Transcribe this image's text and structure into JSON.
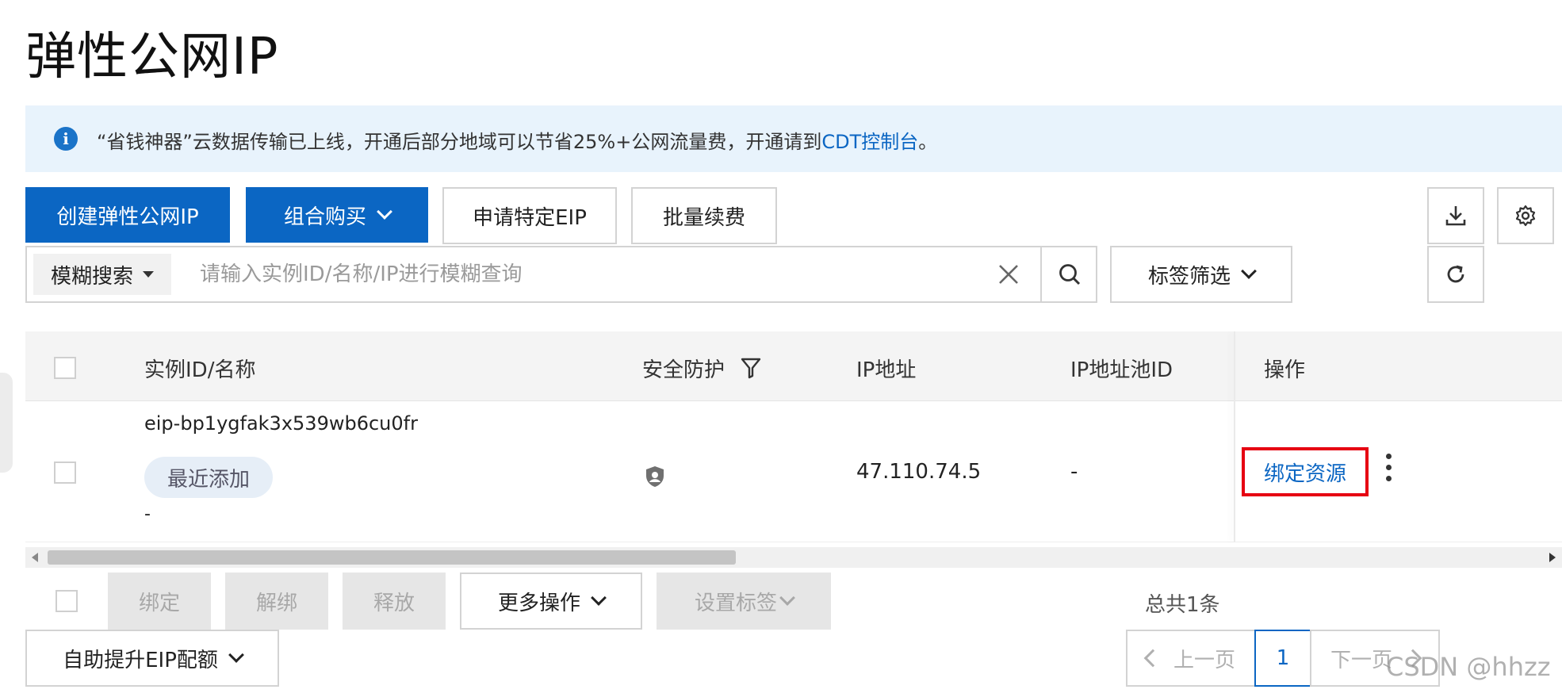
{
  "page": {
    "title": "弹性公网IP"
  },
  "notice": {
    "icon": "info-icon",
    "text": "“省钱神器”云数据传输已上线，开通后部分地域可以节省25%+公网流量费，开通请到",
    "link": "CDT控制台",
    "suffix": "。",
    "color": "#e8f3fc"
  },
  "toolbar": {
    "create": "创建弹性公网IP",
    "combo_buy": "组合购买",
    "apply_eip": "申请特定EIP",
    "batch_renew": "批量续费",
    "download_icon": "download-icon",
    "settings_icon": "gear-icon",
    "refresh_icon": "refresh-icon"
  },
  "search": {
    "mode": "模糊搜索",
    "placeholder": "请输入实例ID/名称/IP进行模糊查询",
    "value": "",
    "tag_filter": "标签筛选"
  },
  "table": {
    "headers": {
      "name": "实例ID/名称",
      "security": "安全防护",
      "ip": "IP地址",
      "pool": "IP地址池ID",
      "actions": "操作"
    },
    "rows": [
      {
        "id": "eip-bp1ygfak3x539wb6cu0fr",
        "tag": "最近添加",
        "name": "-",
        "security_icon": "shield-icon",
        "ip": "47.110.74.5",
        "pool": "-",
        "action": "绑定资源"
      }
    ]
  },
  "bulk": {
    "bind": "绑定",
    "unbind": "解绑",
    "release": "释放",
    "more": "更多操作",
    "set_tags": "设置标签",
    "total": "总共1条"
  },
  "quota": {
    "label": "自助提升EIP配额"
  },
  "pager": {
    "prev": "上一页",
    "current": "1",
    "next": "下一页"
  },
  "watermark": "CSDN @hhzz",
  "colors": {
    "primary": "#0b66c3",
    "highlight": "#e60012"
  }
}
